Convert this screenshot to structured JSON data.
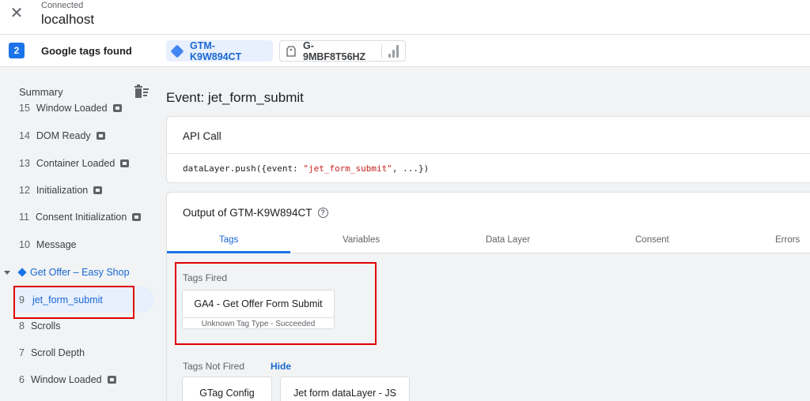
{
  "header": {
    "close_icon": "close-icon",
    "status": "Connected",
    "host": "localhost"
  },
  "tags_bar": {
    "count": "2",
    "label": "Google tags found",
    "chips": [
      {
        "label": "GTM-K9W894CT",
        "icon": "gtm-diamond-icon",
        "active": true
      },
      {
        "label": "G-9MBF8T56HZ",
        "icon": "tag-icon",
        "trailing_icon": "analytics-bars-icon",
        "active": false
      }
    ]
  },
  "sidebar": {
    "summary_label": "Summary",
    "clear_icon": "clear-list-icon",
    "partial_item": {
      "number": "15",
      "label": "Window Loaded"
    },
    "events": [
      {
        "number": "14",
        "label": "DOM Ready",
        "has_code_icon": true
      },
      {
        "number": "13",
        "label": "Container Loaded",
        "has_code_icon": true
      },
      {
        "number": "12",
        "label": "Initialization",
        "has_code_icon": true
      },
      {
        "number": "11",
        "label": "Consent Initialization",
        "has_code_icon": true
      },
      {
        "number": "10",
        "label": "Message",
        "has_code_icon": false
      }
    ],
    "group": {
      "label": "Get Offer – Easy Shop",
      "expanded": true
    },
    "selected_event": {
      "number": "9",
      "label": "jet_form_submit"
    },
    "events_after": [
      {
        "number": "8",
        "label": "Scrolls",
        "has_code_icon": false
      },
      {
        "number": "7",
        "label": "Scroll Depth",
        "has_code_icon": false
      },
      {
        "number": "6",
        "label": "Window Loaded",
        "has_code_icon": true
      }
    ]
  },
  "main": {
    "event_title": "Event: jet_form_submit",
    "api_card": {
      "title": "API Call",
      "code_prefix": "dataLayer.push({event: ",
      "code_string": "\"jet_form_submit\"",
      "code_suffix": ", ...})"
    },
    "output_card": {
      "title": "Output of GTM-K9W894CT",
      "help_icon": "help-circle-icon",
      "tabs": [
        "Tags",
        "Variables",
        "Data Layer",
        "Consent",
        "Errors"
      ],
      "active_tab": "Tags",
      "tags_fired_label": "Tags Fired",
      "tags_fired": [
        {
          "name": "GA4 - Get Offer Form Submit",
          "status": "Unknown Tag Type - Succeeded"
        }
      ],
      "tags_not_fired_label": "Tags Not Fired",
      "hide_label": "Hide",
      "tags_not_fired": [
        {
          "name": "GTag Config"
        },
        {
          "name": "Jet form dataLayer - JS"
        }
      ]
    }
  },
  "colors": {
    "accent": "#1a73e8",
    "highlight_red": "#e00000",
    "code_string": "#c5221f"
  }
}
